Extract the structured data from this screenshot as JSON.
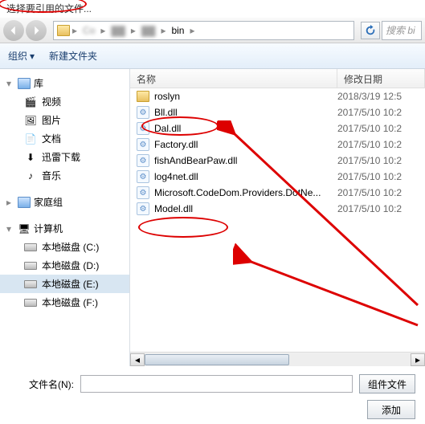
{
  "window": {
    "title": "选择要引用的文件..."
  },
  "breadcrumb": {
    "seg_blur1": "Co",
    "seg_blur2": "▓▓",
    "seg_blur3": "▓▓",
    "seg_bin": "bin"
  },
  "search": {
    "placeholder": "搜索 bi"
  },
  "toolbar": {
    "organize": "组织",
    "newfolder": "新建文件夹"
  },
  "sidebar": {
    "lib_head": "库",
    "lib_items": [
      "视频",
      "图片",
      "文档",
      "迅雷下载",
      "音乐"
    ],
    "home_head": "家庭组",
    "pc_head": "计算机",
    "drives": [
      "本地磁盘 (C:)",
      "本地磁盘 (D:)",
      "本地磁盘 (E:)",
      "本地磁盘 (F:)"
    ]
  },
  "columns": {
    "name": "名称",
    "date": "修改日期"
  },
  "files": [
    {
      "icon": "folder",
      "name": "roslyn",
      "date": "2018/3/19 12:5"
    },
    {
      "icon": "dll",
      "name": "Bll.dll",
      "date": "2017/5/10 10:2"
    },
    {
      "icon": "dll",
      "name": "Dal.dll",
      "date": "2017/5/10 10:2"
    },
    {
      "icon": "dll",
      "name": "Factory.dll",
      "date": "2017/5/10 10:2"
    },
    {
      "icon": "dll",
      "name": "fishAndBearPaw.dll",
      "date": "2017/5/10 10:2"
    },
    {
      "icon": "dll",
      "name": "log4net.dll",
      "date": "2017/5/10 10:2"
    },
    {
      "icon": "dll",
      "name": "Microsoft.CodeDom.Providers.DotNe...",
      "date": "2017/5/10 10:2"
    },
    {
      "icon": "dll",
      "name": "Model.dll",
      "date": "2017/5/10 10:2"
    }
  ],
  "footer": {
    "filename_label": "文件名(N):",
    "filename_value": "",
    "filter_btn": "组件文件",
    "add_btn": "添加"
  }
}
